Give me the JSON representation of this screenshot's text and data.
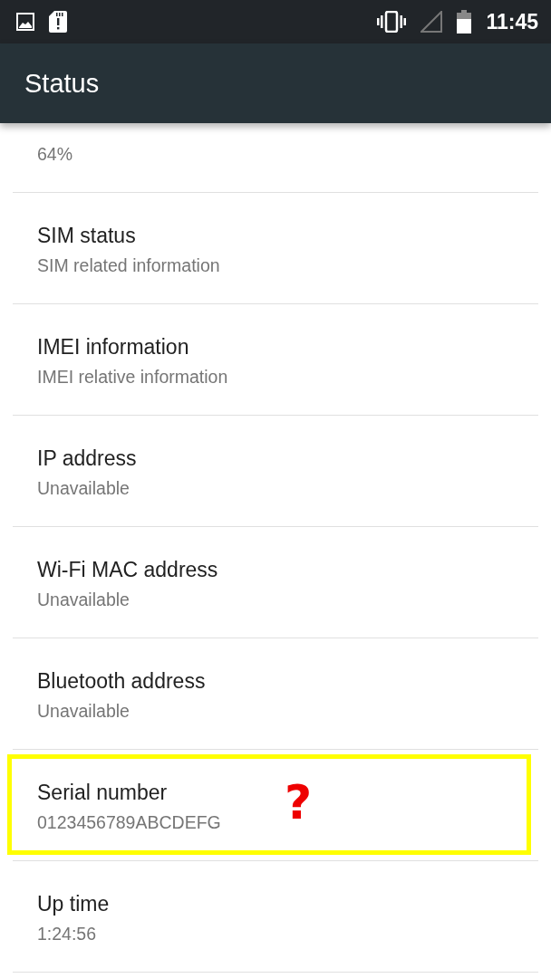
{
  "status_bar": {
    "time": "11:45"
  },
  "app_bar": {
    "title": "Status"
  },
  "items": [
    {
      "summary": "64%",
      "highlighted": false
    },
    {
      "title": "SIM status",
      "summary": "SIM related information",
      "highlighted": false
    },
    {
      "title": "IMEI information",
      "summary": "IMEI relative information",
      "highlighted": false
    },
    {
      "title": "IP address",
      "summary": "Unavailable",
      "highlighted": false
    },
    {
      "title": "Wi-Fi MAC address",
      "summary": "Unavailable",
      "highlighted": false
    },
    {
      "title": "Bluetooth address",
      "summary": "Unavailable",
      "highlighted": false
    },
    {
      "title": "Serial number",
      "summary": "0123456789ABCDEFG",
      "highlighted": true,
      "annotation": "?"
    },
    {
      "title": "Up time",
      "summary": "1:24:56",
      "highlighted": false
    }
  ]
}
